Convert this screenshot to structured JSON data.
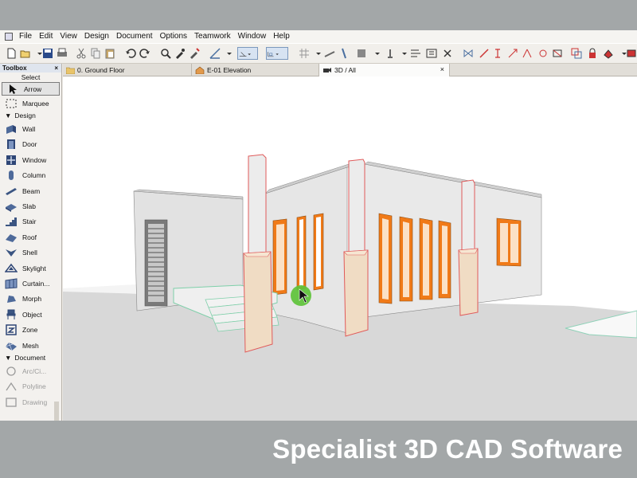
{
  "menu": [
    "File",
    "Edit",
    "View",
    "Design",
    "Document",
    "Options",
    "Teamwork",
    "Window",
    "Help"
  ],
  "tabs": [
    {
      "label": "0. Ground Floor",
      "icon": "folder-icon"
    },
    {
      "label": "E-01 Elevation",
      "icon": "elevation-house-icon"
    },
    {
      "label": "3D / All",
      "icon": "camera-3d-icon",
      "active": true
    }
  ],
  "tab_close": "×",
  "toolbox": {
    "title": "Toolbox",
    "close": "×",
    "select_label": "Select",
    "select_tools": [
      {
        "label": "Arrow",
        "icon": "arrow-cursor-icon"
      },
      {
        "label": "Marquee",
        "icon": "marquee-icon"
      }
    ],
    "design_label": "Design",
    "design_tools": [
      {
        "label": "Wall",
        "icon": "wall-icon"
      },
      {
        "label": "Door",
        "icon": "door-icon"
      },
      {
        "label": "Window",
        "icon": "window-icon"
      },
      {
        "label": "Column",
        "icon": "column-icon"
      },
      {
        "label": "Beam",
        "icon": "beam-icon"
      },
      {
        "label": "Slab",
        "icon": "slab-icon"
      },
      {
        "label": "Stair",
        "icon": "stair-icon"
      },
      {
        "label": "Roof",
        "icon": "roof-icon"
      },
      {
        "label": "Shell",
        "icon": "shell-icon"
      },
      {
        "label": "Skylight",
        "icon": "skylight-icon"
      },
      {
        "label": "Curtain...",
        "icon": "curtain-wall-icon"
      },
      {
        "label": "Morph",
        "icon": "morph-icon"
      },
      {
        "label": "Object",
        "icon": "object-icon"
      },
      {
        "label": "Zone",
        "icon": "zone-icon"
      },
      {
        "label": "Mesh",
        "icon": "mesh-icon"
      }
    ],
    "document_label": "Document",
    "document_tools": [
      {
        "label": "Arc/Ci...",
        "icon": "arc-circle-icon"
      },
      {
        "label": "Polyline",
        "icon": "polyline-icon"
      },
      {
        "label": "Drawing",
        "icon": "drawing-icon"
      }
    ]
  },
  "caption": "Specialist 3D CAD Software",
  "colors": {
    "accent_window": "#f07a18",
    "column_outline": "#e05a5a",
    "cursor_highlight": "#5ec33a"
  }
}
